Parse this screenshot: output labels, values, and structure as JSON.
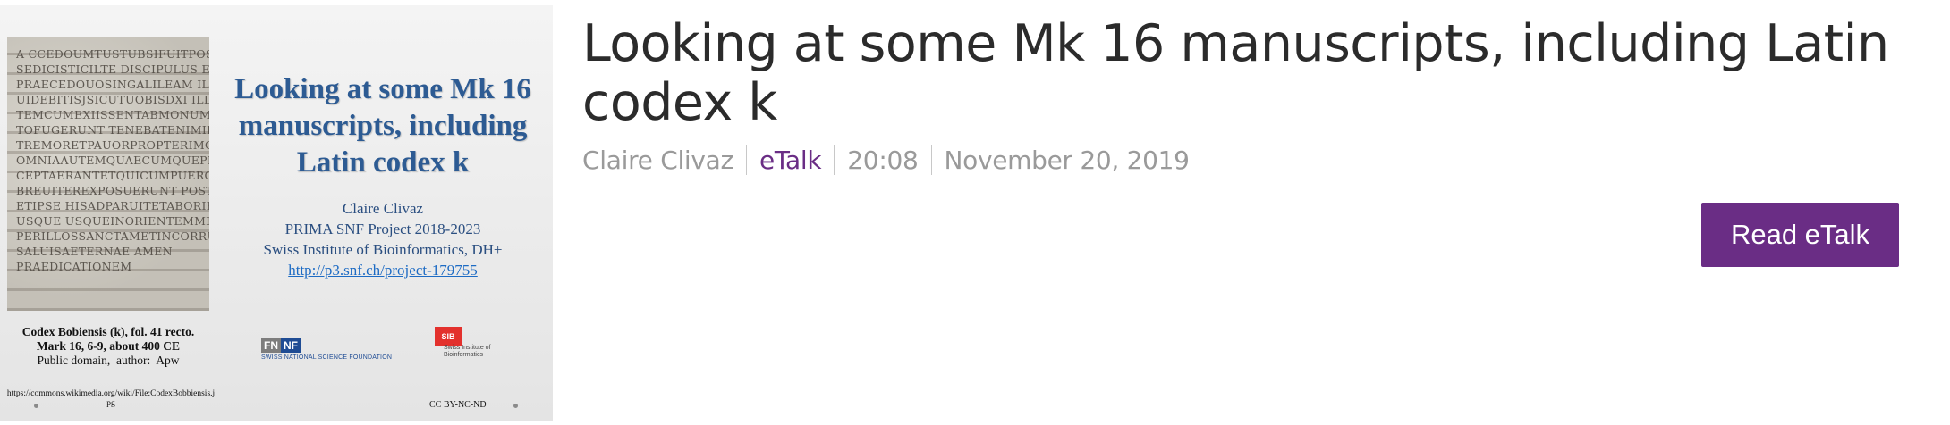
{
  "thumbnail": {
    "manuscript_lines": [
      "A ccedoumtustubsifuitpositus",
      "sedicisticilte discipulus et petro",
      "praecedouosingalileam illicme",
      "uidebitisjsicutuobisdxi illaeau",
      "temcumexiissentabmonumie",
      "tofugerunt tenebatenimillas",
      "tremoretpauorpropterimore",
      "omniaautemquaecumqueprae",
      "ceptaerantetquicumpueroerant",
      "breuiterexposuerunt posthaec",
      "etipse hisadparuitetaboriente",
      "usque usqueinorientemmisit",
      "perillossanctametincorruptam",
      "saluisaeternae amen",
      "praedicationem"
    ],
    "slide_title": "Looking at some Mk 16 manuscripts, including Latin codex k",
    "author": "Claire Clivaz",
    "project": "PRIMA SNF Project 2018-2023",
    "institute": "Swiss Institute of Bioinformatics, DH+",
    "link": "http://p3.snf.ch/project-179755",
    "caption_line1": "Codex Bobiensis (k), fol. 41 recto.",
    "caption_line2": "Mark 16, 6-9, about 400 CE",
    "caption_line3": "Public domain,  author:  Apw",
    "wiki_url": "https://commons.wikimedia.org/wiki/File:CodexBobbiensis.jpg",
    "license": "CC BY-NC-ND",
    "snf_fn": "FN",
    "snf_nf": "NF",
    "snf_name": "SWISS NATIONAL SCIENCE FOUNDATION",
    "sib_mark": "SIB",
    "sib_name_line1": "Swiss Institute of",
    "sib_name_line2": "Bioinformatics"
  },
  "talk": {
    "title": "Looking at some Mk 16 manuscripts, including Latin codex k",
    "author": "Claire Clivaz",
    "type": "eTalk",
    "duration": "20:08",
    "date": "November 20, 2019",
    "read_label": "Read eTalk"
  },
  "colors": {
    "accent": "#6a2d85",
    "slide_title": "#2d5b93",
    "meta_text": "#9a9a9a",
    "title_text": "#2b2b2b"
  }
}
